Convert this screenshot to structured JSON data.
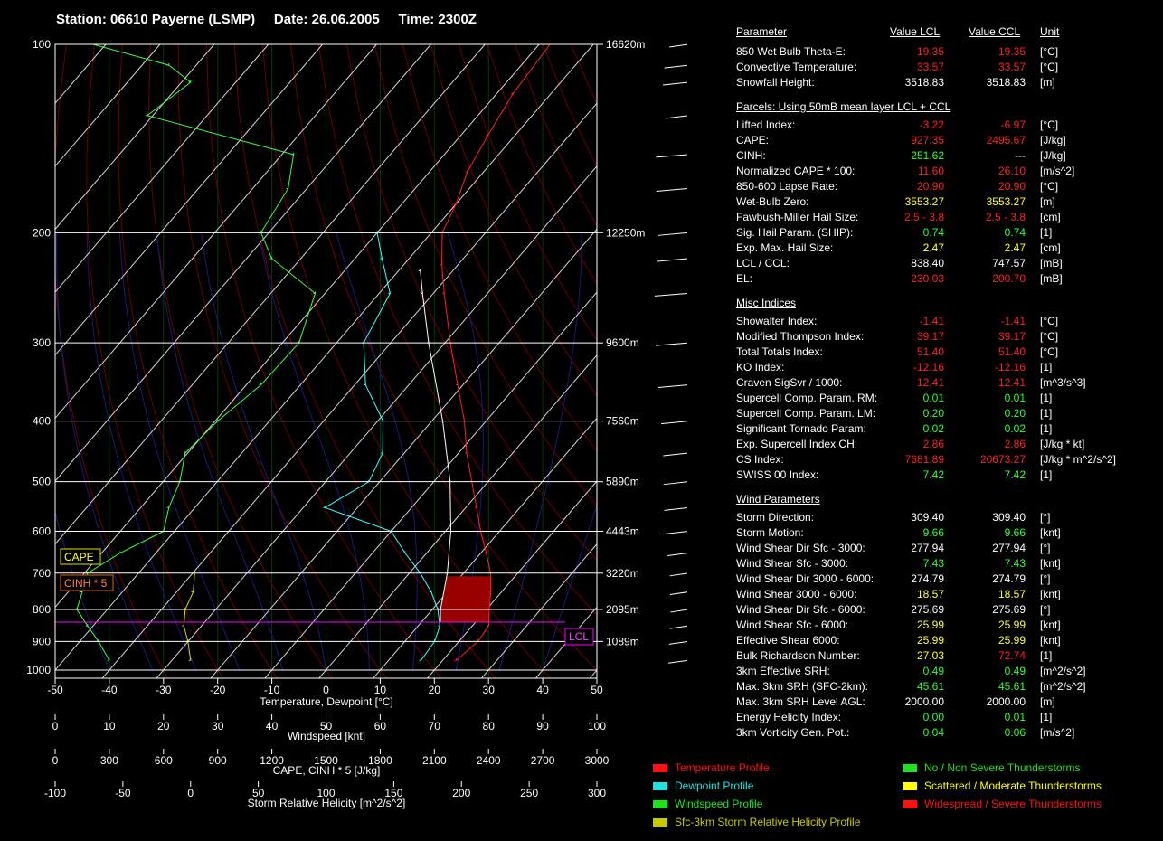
{
  "header": {
    "station": "Station: 06610 Payerne (LSMP)",
    "date": "Date: 26.06.2005",
    "time": "Time: 2300Z"
  },
  "chart_data": {
    "type": "skew-t",
    "pressure_levels": [
      100,
      200,
      300,
      400,
      500,
      600,
      700,
      800,
      900,
      1000
    ],
    "height_labels": [
      {
        "p": 100,
        "label": "16620m"
      },
      {
        "p": 200,
        "label": "12250m"
      },
      {
        "p": 300,
        "label": "9600m"
      },
      {
        "p": 400,
        "label": "7560m"
      },
      {
        "p": 500,
        "label": "5890m"
      },
      {
        "p": 600,
        "label": "4443m"
      },
      {
        "p": 700,
        "label": "3220m"
      },
      {
        "p": 800,
        "label": "2095m"
      },
      {
        "p": 900,
        "label": "1089m"
      }
    ],
    "temperature_ticks": [
      "-50",
      "-40",
      "-30",
      "-20",
      "-10",
      "0",
      "10",
      "20",
      "30",
      "40",
      "50"
    ],
    "windspeed_ticks": [
      "0",
      "10",
      "20",
      "30",
      "40",
      "50",
      "60",
      "70",
      "80",
      "90",
      "100"
    ],
    "cape_ticks": [
      "0",
      "300",
      "600",
      "900",
      "1200",
      "1500",
      "1800",
      "2100",
      "2400",
      "2700",
      "3000"
    ],
    "helicity_ticks": [
      "-100",
      "-50",
      "0",
      "50",
      "100",
      "150",
      "200",
      "250",
      "300"
    ],
    "xlabel_temperature": "Temperature, Dewpoint [°C]",
    "xlabel_windspeed": "Windspeed [knt]",
    "xlabel_cape": "CAPE, CINH * 5 [J/kg]",
    "xlabel_helicity": "Storm Relative Helicity [m^2/s^2]",
    "labels": {
      "cape": "CAPE",
      "cinh": "CINH * 5",
      "lcl": "LCL"
    },
    "temperature_profile": [
      {
        "p": 965,
        "t": 22.5
      },
      {
        "p": 900,
        "t": 23.5
      },
      {
        "p": 850,
        "t": 23
      },
      {
        "p": 800,
        "t": 20.5
      },
      {
        "p": 750,
        "t": 18
      },
      {
        "p": 700,
        "t": 15
      },
      {
        "p": 650,
        "t": 11
      },
      {
        "p": 600,
        "t": 6.5
      },
      {
        "p": 550,
        "t": 2
      },
      {
        "p": 500,
        "t": -3
      },
      {
        "p": 450,
        "t": -8.5
      },
      {
        "p": 400,
        "t": -14
      },
      {
        "p": 350,
        "t": -21
      },
      {
        "p": 300,
        "t": -29
      },
      {
        "p": 250,
        "t": -38
      },
      {
        "p": 225,
        "t": -43
      },
      {
        "p": 200,
        "t": -48
      },
      {
        "p": 180,
        "t": -50
      },
      {
        "p": 160,
        "t": -53
      },
      {
        "p": 140,
        "t": -55
      },
      {
        "p": 120,
        "t": -57
      },
      {
        "p": 100,
        "t": -58
      }
    ],
    "dewpoint_profile": [
      {
        "p": 965,
        "t": 16
      },
      {
        "p": 900,
        "t": 15.5
      },
      {
        "p": 850,
        "t": 14
      },
      {
        "p": 800,
        "t": 11
      },
      {
        "p": 750,
        "t": 7
      },
      {
        "p": 700,
        "t": 2
      },
      {
        "p": 650,
        "t": -4
      },
      {
        "p": 600,
        "t": -10
      },
      {
        "p": 550,
        "t": -26
      },
      {
        "p": 500,
        "t": -22
      },
      {
        "p": 450,
        "t": -24
      },
      {
        "p": 400,
        "t": -29
      },
      {
        "p": 350,
        "t": -38
      },
      {
        "p": 300,
        "t": -45
      },
      {
        "p": 250,
        "t": -48
      },
      {
        "p": 220,
        "t": -55
      },
      {
        "p": 200,
        "t": -60
      }
    ],
    "parcel_profile": [
      {
        "p": 838,
        "t": 13.5
      },
      {
        "p": 800,
        "t": 11.5
      },
      {
        "p": 700,
        "t": 7
      },
      {
        "p": 600,
        "t": 1
      },
      {
        "p": 500,
        "t": -7
      },
      {
        "p": 400,
        "t": -18
      },
      {
        "p": 300,
        "t": -33
      },
      {
        "p": 250,
        "t": -42
      },
      {
        "p": 230,
        "t": -46
      }
    ],
    "windspeed_profile": [
      {
        "p": 965,
        "s": 10
      },
      {
        "p": 900,
        "s": 8
      },
      {
        "p": 850,
        "s": 6
      },
      {
        "p": 800,
        "s": 4
      },
      {
        "p": 750,
        "s": 5
      },
      {
        "p": 700,
        "s": 6
      },
      {
        "p": 650,
        "s": 12
      },
      {
        "p": 600,
        "s": 20
      },
      {
        "p": 550,
        "s": 21
      },
      {
        "p": 500,
        "s": 23
      },
      {
        "p": 450,
        "s": 24
      },
      {
        "p": 400,
        "s": 30
      },
      {
        "p": 350,
        "s": 38
      },
      {
        "p": 300,
        "s": 45
      },
      {
        "p": 250,
        "s": 48
      },
      {
        "p": 220,
        "s": 40
      },
      {
        "p": 200,
        "s": 38
      },
      {
        "p": 170,
        "s": 43
      },
      {
        "p": 150,
        "s": 44
      },
      {
        "p": 130,
        "s": 17
      },
      {
        "p": 115,
        "s": 25
      },
      {
        "p": 108,
        "s": 21
      },
      {
        "p": 100,
        "s": 7
      }
    ],
    "srh_profile": [
      {
        "p": 965,
        "h": 0
      },
      {
        "p": 900,
        "h": -2
      },
      {
        "p": 850,
        "h": -5
      },
      {
        "p": 800,
        "h": -4
      },
      {
        "p": 750,
        "h": 2
      },
      {
        "p": 700,
        "h": 3
      }
    ],
    "lcl_pressure": 838.4,
    "ccl_pressure": 747.57
  },
  "table": {
    "headers": [
      "Parameter",
      "Value LCL",
      "Value CCL",
      "Unit"
    ],
    "sections": [
      {
        "title": "",
        "rows": [
          {
            "name": "850 Wet Bulb Theta-E:",
            "lcl": "19.35",
            "ccl": "19.35",
            "unit": "[°C]",
            "lcl_color": "#ff2020",
            "ccl_color": "#ff2020"
          },
          {
            "name": "Convective Temperature:",
            "lcl": "33.57",
            "ccl": "33.57",
            "unit": "[°C]",
            "lcl_color": "#ff2020",
            "ccl_color": "#ff2020"
          },
          {
            "name": "Snowfall Height:",
            "lcl": "3518.83",
            "ccl": "3518.83",
            "unit": "[m]",
            "lcl_color": "#ffffff",
            "ccl_color": "#ffffff"
          }
        ]
      },
      {
        "title": "Parcels: Using 50mB mean layer LCL + CCL",
        "rows": [
          {
            "name": "Lifted Index:",
            "lcl": "-3.22",
            "ccl": "-6.97",
            "unit": "[°C]",
            "lcl_color": "#ff2020",
            "ccl_color": "#ff2020"
          },
          {
            "name": "CAPE:",
            "lcl": "927.35",
            "ccl": "2495.67",
            "unit": "[J/kg]",
            "lcl_color": "#ff2020",
            "ccl_color": "#ff2020"
          },
          {
            "name": "CINH:",
            "lcl": "251.62",
            "ccl": "---",
            "unit": "[J/kg]",
            "lcl_color": "#30ff30",
            "ccl_color": "#ffffff"
          },
          {
            "name": "Normalized CAPE * 100:",
            "lcl": "11.60",
            "ccl": "26.10",
            "unit": "[m/s^2]",
            "lcl_color": "#ff2020",
            "ccl_color": "#ff2020"
          },
          {
            "name": "850-600 Lapse Rate:",
            "lcl": "20.90",
            "ccl": "20.90",
            "unit": "[°C]",
            "lcl_color": "#ff2020",
            "ccl_color": "#ff2020"
          },
          {
            "name": "Wet-Bulb Zero:",
            "lcl": "3553.27",
            "ccl": "3553.27",
            "unit": "[m]",
            "lcl_color": "#ffff30",
            "ccl_color": "#ffff30"
          },
          {
            "name": "Fawbush-Miller Hail Size:",
            "lcl": "2.5 - 3.8",
            "ccl": "2.5 - 3.8",
            "unit": "[cm]",
            "lcl_color": "#ff2020",
            "ccl_color": "#ff2020"
          },
          {
            "name": "Sig. Hail Param. (SHIP):",
            "lcl": "0.74",
            "ccl": "0.74",
            "unit": "[1]",
            "lcl_color": "#30ff30",
            "ccl_color": "#30ff30"
          },
          {
            "name": "Exp. Max. Hail Size:",
            "lcl": "2.47",
            "ccl": "2.47",
            "unit": "[cm]",
            "lcl_color": "#ffff30",
            "ccl_color": "#ffff30"
          },
          {
            "name": "LCL / CCL:",
            "lcl": "838.40",
            "ccl": "747.57",
            "unit": "[mB]",
            "lcl_color": "#ffffff",
            "ccl_color": "#ffffff"
          },
          {
            "name": "EL:",
            "lcl": "230.03",
            "ccl": "200.70",
            "unit": "[mB]",
            "lcl_color": "#ff2020",
            "ccl_color": "#ff2020"
          }
        ]
      },
      {
        "title": "Misc Indices",
        "rows": [
          {
            "name": "Showalter Index:",
            "lcl": "-1.41",
            "ccl": "-1.41",
            "unit": "[°C]",
            "lcl_color": "#ff2020",
            "ccl_color": "#ff2020"
          },
          {
            "name": "Modified Thompson Index:",
            "lcl": "39.17",
            "ccl": "39.17",
            "unit": "[°C]",
            "lcl_color": "#ff2020",
            "ccl_color": "#ff2020"
          },
          {
            "name": "Total Totals Index:",
            "lcl": "51.40",
            "ccl": "51.40",
            "unit": "[°C]",
            "lcl_color": "#ff2020",
            "ccl_color": "#ff2020"
          },
          {
            "name": "KO Index:",
            "lcl": "-12.16",
            "ccl": "-12.16",
            "unit": "[1]",
            "lcl_color": "#ff2020",
            "ccl_color": "#ff2020"
          },
          {
            "name": "Craven SigSvr / 1000:",
            "lcl": "12.41",
            "ccl": "12.41",
            "unit": "[m^3/s^3]",
            "lcl_color": "#ff2020",
            "ccl_color": "#ff2020"
          },
          {
            "name": "Supercell Comp. Param. RM:",
            "lcl": "0.01",
            "ccl": "0.01",
            "unit": "[1]",
            "lcl_color": "#30ff30",
            "ccl_color": "#30ff30"
          },
          {
            "name": "Supercell Comp. Param. LM:",
            "lcl": "0.20",
            "ccl": "0.20",
            "unit": "[1]",
            "lcl_color": "#30ff30",
            "ccl_color": "#30ff30"
          },
          {
            "name": "Significant Tornado Param:",
            "lcl": "0.02",
            "ccl": "0.02",
            "unit": "[1]",
            "lcl_color": "#30ff30",
            "ccl_color": "#30ff30"
          },
          {
            "name": "Exp. Supercell Index CH:",
            "lcl": "2.86",
            "ccl": "2.86",
            "unit": "[J/kg * kt]",
            "lcl_color": "#ff2020",
            "ccl_color": "#ff2020"
          },
          {
            "name": "CS Index:",
            "lcl": "7681.89",
            "ccl": "20673.27",
            "unit": "[J/kg * m^2/s^2]",
            "lcl_color": "#ff2020",
            "ccl_color": "#ff2020"
          },
          {
            "name": "SWISS 00 Index:",
            "lcl": "7.42",
            "ccl": "7.42",
            "unit": "[1]",
            "lcl_color": "#30ff30",
            "ccl_color": "#30ff30"
          }
        ]
      },
      {
        "title": "Wind Parameters",
        "rows": [
          {
            "name": "Storm Direction:",
            "lcl": "309.40",
            "ccl": "309.40",
            "unit": "[°]",
            "lcl_color": "#ffffff",
            "ccl_color": "#ffffff"
          },
          {
            "name": "Storm Motion:",
            "lcl": "9.66",
            "ccl": "9.66",
            "unit": "[knt]",
            "lcl_color": "#30ff30",
            "ccl_color": "#30ff30"
          },
          {
            "name": "Wind Shear Dir Sfc - 3000:",
            "lcl": "277.94",
            "ccl": "277.94",
            "unit": "[°]",
            "lcl_color": "#ffffff",
            "ccl_color": "#ffffff"
          },
          {
            "name": "Wind Shear Sfc - 3000:",
            "lcl": "7.43",
            "ccl": "7.43",
            "unit": "[knt]",
            "lcl_color": "#30ff30",
            "ccl_color": "#30ff30"
          },
          {
            "name": "Wind Shear Dir 3000 - 6000:",
            "lcl": "274.79",
            "ccl": "274.79",
            "unit": "[°]",
            "lcl_color": "#ffffff",
            "ccl_color": "#ffffff"
          },
          {
            "name": "Wind Shear 3000 - 6000:",
            "lcl": "18.57",
            "ccl": "18.57",
            "unit": "[knt]",
            "lcl_color": "#ffff30",
            "ccl_color": "#ffff30"
          },
          {
            "name": "Wind Shear Dir Sfc - 6000:",
            "lcl": "275.69",
            "ccl": "275.69",
            "unit": "[°]",
            "lcl_color": "#ffffff",
            "ccl_color": "#ffffff"
          },
          {
            "name": "Wind Shear Sfc - 6000:",
            "lcl": "25.99",
            "ccl": "25.99",
            "unit": "[knt]",
            "lcl_color": "#ffff30",
            "ccl_color": "#ffff30"
          },
          {
            "name": "Effective Shear 6000:",
            "lcl": "25.99",
            "ccl": "25.99",
            "unit": "[knt]",
            "lcl_color": "#ffff30",
            "ccl_color": "#ffff30"
          },
          {
            "name": "Bulk Richardson Number:",
            "lcl": "27.03",
            "ccl": "72.74",
            "unit": "[1]",
            "lcl_color": "#ffff30",
            "ccl_color": "#ff2020"
          },
          {
            "name": "3km Effective SRH:",
            "lcl": "0.49",
            "ccl": "0.49",
            "unit": "[m^2/s^2]",
            "lcl_color": "#30ff30",
            "ccl_color": "#30ff30"
          },
          {
            "name": "Max. 3km SRH (SFC-2km):",
            "lcl": "45.61",
            "ccl": "45.61",
            "unit": "[m^2/s^2]",
            "lcl_color": "#30ff30",
            "ccl_color": "#30ff30"
          },
          {
            "name": "Max. 3km SRH Level AGL:",
            "lcl": "2000.00",
            "ccl": "2000.00",
            "unit": "[m]",
            "lcl_color": "#ffffff",
            "ccl_color": "#ffffff"
          },
          {
            "name": "Energy Helicity Index:",
            "lcl": "0.00",
            "ccl": "0.01",
            "unit": "[1]",
            "lcl_color": "#30ff30",
            "ccl_color": "#30ff30"
          },
          {
            "name": "3km Vorticity Gen. Pot.:",
            "lcl": "0.04",
            "ccl": "0.06",
            "unit": "[m/s^2]",
            "lcl_color": "#30ff30",
            "ccl_color": "#30ff30"
          }
        ]
      }
    ]
  },
  "legend": [
    {
      "label": "Temperature Profile",
      "color": "#ff1010"
    },
    {
      "label": "Dewpoint Profile",
      "color": "#20e0e0"
    },
    {
      "label": "Windspeed Profile",
      "color": "#20e020"
    },
    {
      "label": "Sfc-3km Storm Relative Helicity Profile",
      "color": "#c8c800"
    },
    {
      "label": "No / Non Severe Thunderstorms",
      "color": "#20e020"
    },
    {
      "label": "Scattered / Moderate Thunderstorms",
      "color": "#ffff00"
    },
    {
      "label": "Widespread / Severe Thunderstorms",
      "color": "#ff1010"
    }
  ],
  "colors": {
    "temperature": "#ff2020",
    "dewpoint": "#40ffff",
    "windspeed": "#40ff40",
    "srh": "#d8d800",
    "positive_area": "#008800",
    "negative_area": "#990000",
    "lcl": "#ff00ff",
    "parcel": "#ffffff"
  }
}
